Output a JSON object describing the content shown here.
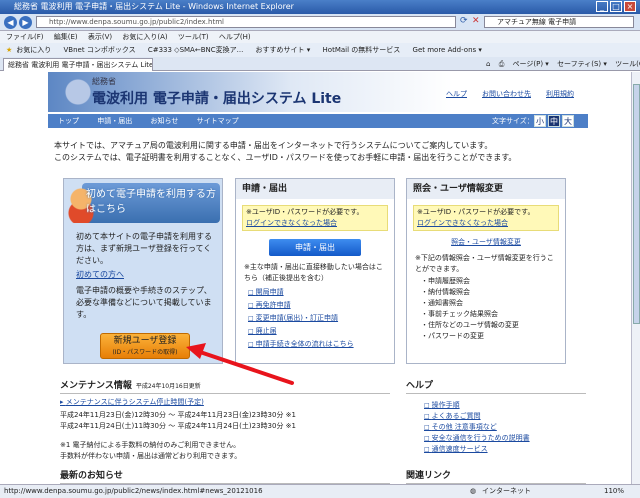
{
  "window": {
    "title": "総務省 電波利用 電子申請・届出システム Lite - Windows Internet Explorer"
  },
  "browser": {
    "address": "http://www.denpa.soumu.go.jp/public2/index.html",
    "search_value": "アマチュア無線 電子申請",
    "menu": [
      "ファイル(F)",
      "編集(E)",
      "表示(V)",
      "お気に入り(A)",
      "ツール(T)",
      "ヘルプ(H)"
    ],
    "favorites_label": "お気に入り",
    "favorites": [
      "VBnet コンポボックス",
      "C#333 ◇SMA←BNC変換ア...",
      "おすすめサイト ▾",
      "HotMail の無料サービス",
      "Get more Add-ons ▾"
    ],
    "tab_title": "総務省 電波利用 電子申請・届出システム Lite",
    "tools": [
      "ページ(P) ▾",
      "セーフティ(S) ▾",
      "ツール(O) ▾"
    ],
    "status_url": "http://www.denpa.soumu.go.jp/public2/news/index.html#news_20121016",
    "status_zone": "インターネット",
    "zoom": "110%"
  },
  "site": {
    "org": "総務省",
    "system_title": "電波利用 電子申請・届出システム Lite",
    "header_links": [
      "ヘルプ",
      "お問い合わせ先",
      "利用規約"
    ],
    "nav": [
      "トップ",
      "申請・届出",
      "お知らせ",
      "サイトマップ"
    ],
    "font_size_label": "文字サイズ：",
    "font_sizes": [
      "小",
      "中",
      "大"
    ],
    "intro1": "本サイトでは、アマチュア局の電波利用に関する申請・届出をインターネットで行うシステムについてご案内しています。",
    "intro2": "このシステムでは、電子証明書を利用することなく、ユーザID・パスワードを使ってお手軽に申請・届出を行うことができます。"
  },
  "left_panel": {
    "title": "初めて電子申請を利用する方はこちら",
    "text1": "初めて本サイトの電子申請を利用する方は、まず新規ユーザ登録を行ってください。",
    "first_link": "初めての方へ",
    "text2": "電子申請の概要や手続きのステップ、必要な準備などについて掲載しています。",
    "register_label": "新規ユーザ登録",
    "register_sub": "(ID・パスワードの取得)"
  },
  "middle_panel": {
    "heading": "申請・届出",
    "required": "※ユーザID・パスワードが必要です。",
    "cannot_login": "ログインできなくなった場合",
    "button": "申請・届出",
    "note": "※主な申請・届出に直接移動したい場合はこちら（補正後提出を含む）",
    "links": [
      "開局申請",
      "再免許申請",
      "変更申請(届出)・訂正申請",
      "廃止届",
      "申請手続き全体の流れはこちら"
    ]
  },
  "right_panel": {
    "heading": "照会・ユーザ情報変更",
    "required": "※ユーザID・パスワードが必要です。",
    "cannot_login": "ログインできなくなった場合",
    "inquiry_link": "照会・ユーザ情報変更",
    "note": "※下記の情報照会・ユーザ情報変更を行うことができます。",
    "items": [
      "申請履歴照会",
      "納付情報照会",
      "通知書照会",
      "事前チェック結果照会",
      "住所などのユーザ情報の変更",
      "パスワードの変更"
    ]
  },
  "maintenance": {
    "heading": "メンテナンス情報",
    "updated": "平成24年10月16日更新",
    "link": "メンテナンスに伴うシステム停止時間(予定)",
    "lines": [
      "平成24年11月23日(金)12時30分 ～ 平成24年11月23日(金)23時30分 ※1",
      "平成24年11月24日(土)11時30分 ～ 平成24年11月24日(土)23時30分 ※1"
    ],
    "note1": "※1 電子納付による手数料の納付のみご利用できません。",
    "note2": "手数料が伴わない申請・届出は通常どおり利用できます。",
    "next_heading": "最新のお知らせ"
  },
  "help": {
    "heading": "ヘルプ",
    "links": [
      "操作手順",
      "よくあるご質問",
      "その他 注意事項など",
      "安全な通信を行うための説明書",
      "通信速度サービス"
    ]
  },
  "related": {
    "heading": "関連リンク"
  }
}
